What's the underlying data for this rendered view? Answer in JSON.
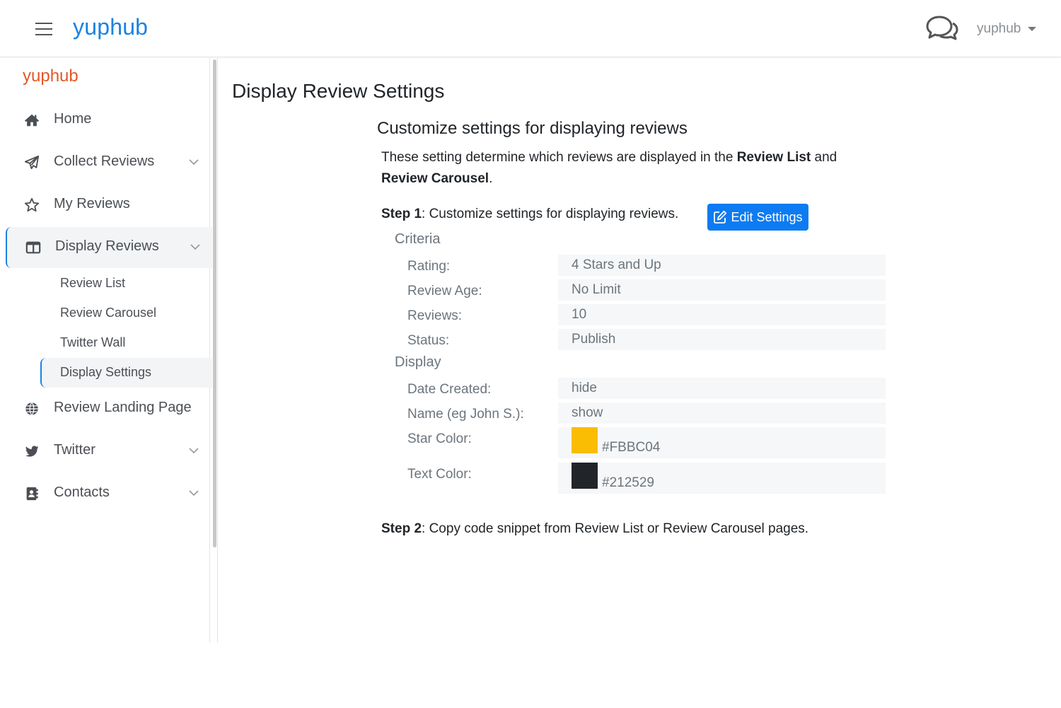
{
  "header": {
    "brand": "yuphub",
    "user_label": "yuphub"
  },
  "sidebar": {
    "brand": "yuphub",
    "items": [
      {
        "label": "Home",
        "icon": "home-icon"
      },
      {
        "label": "Collect Reviews",
        "icon": "paper-plane-icon",
        "expandable": true
      },
      {
        "label": "My Reviews",
        "icon": "star-icon"
      },
      {
        "label": "Display Reviews",
        "icon": "columns-icon",
        "expandable": true,
        "active": true
      },
      {
        "label": "Review Landing Page",
        "icon": "globe-icon"
      },
      {
        "label": "Twitter",
        "icon": "twitter-icon",
        "expandable": true
      },
      {
        "label": "Contacts",
        "icon": "address-book-icon",
        "expandable": true
      }
    ],
    "display_reviews_sub": [
      {
        "label": "Review List"
      },
      {
        "label": "Review Carousel"
      },
      {
        "label": "Twitter Wall"
      },
      {
        "label": "Display Settings",
        "active": true
      }
    ]
  },
  "main": {
    "page_title": "Display Review Settings",
    "section_title": "Customize settings for displaying reviews",
    "intro_prefix": "These setting determine which reviews are displayed in the ",
    "intro_bold1": "Review List",
    "intro_mid": " and ",
    "intro_bold2": "Review Carousel",
    "intro_suffix": ".",
    "step1_label": "Step 1",
    "step1_text": ": Customize settings for displaying reviews.",
    "edit_button": "Edit Settings",
    "criteria_heading": "Criteria",
    "criteria": [
      {
        "label": "Rating:",
        "value": "4 Stars and Up"
      },
      {
        "label": "Review Age:",
        "value": "No Limit"
      },
      {
        "label": "Reviews:",
        "value": "10"
      },
      {
        "label": "Status:",
        "value": "Publish"
      }
    ],
    "display_heading": "Display",
    "display": [
      {
        "label": "Date Created:",
        "value": "hide"
      },
      {
        "label": "Name (eg John S.):",
        "value": "show"
      }
    ],
    "colors": [
      {
        "label": "Star Color:",
        "value": "#FBBC04",
        "color": "#FBBC04"
      },
      {
        "label": "Text Color:",
        "value": "#212529",
        "color": "#212529"
      }
    ],
    "step2_label": "Step 2",
    "step2_text": ": Copy code snippet from Review List or Review Carousel pages."
  },
  "colors": {
    "brand_blue": "#1a82e2",
    "sidebar_brand": "#e2582b",
    "button_blue": "#0d7bf2"
  }
}
